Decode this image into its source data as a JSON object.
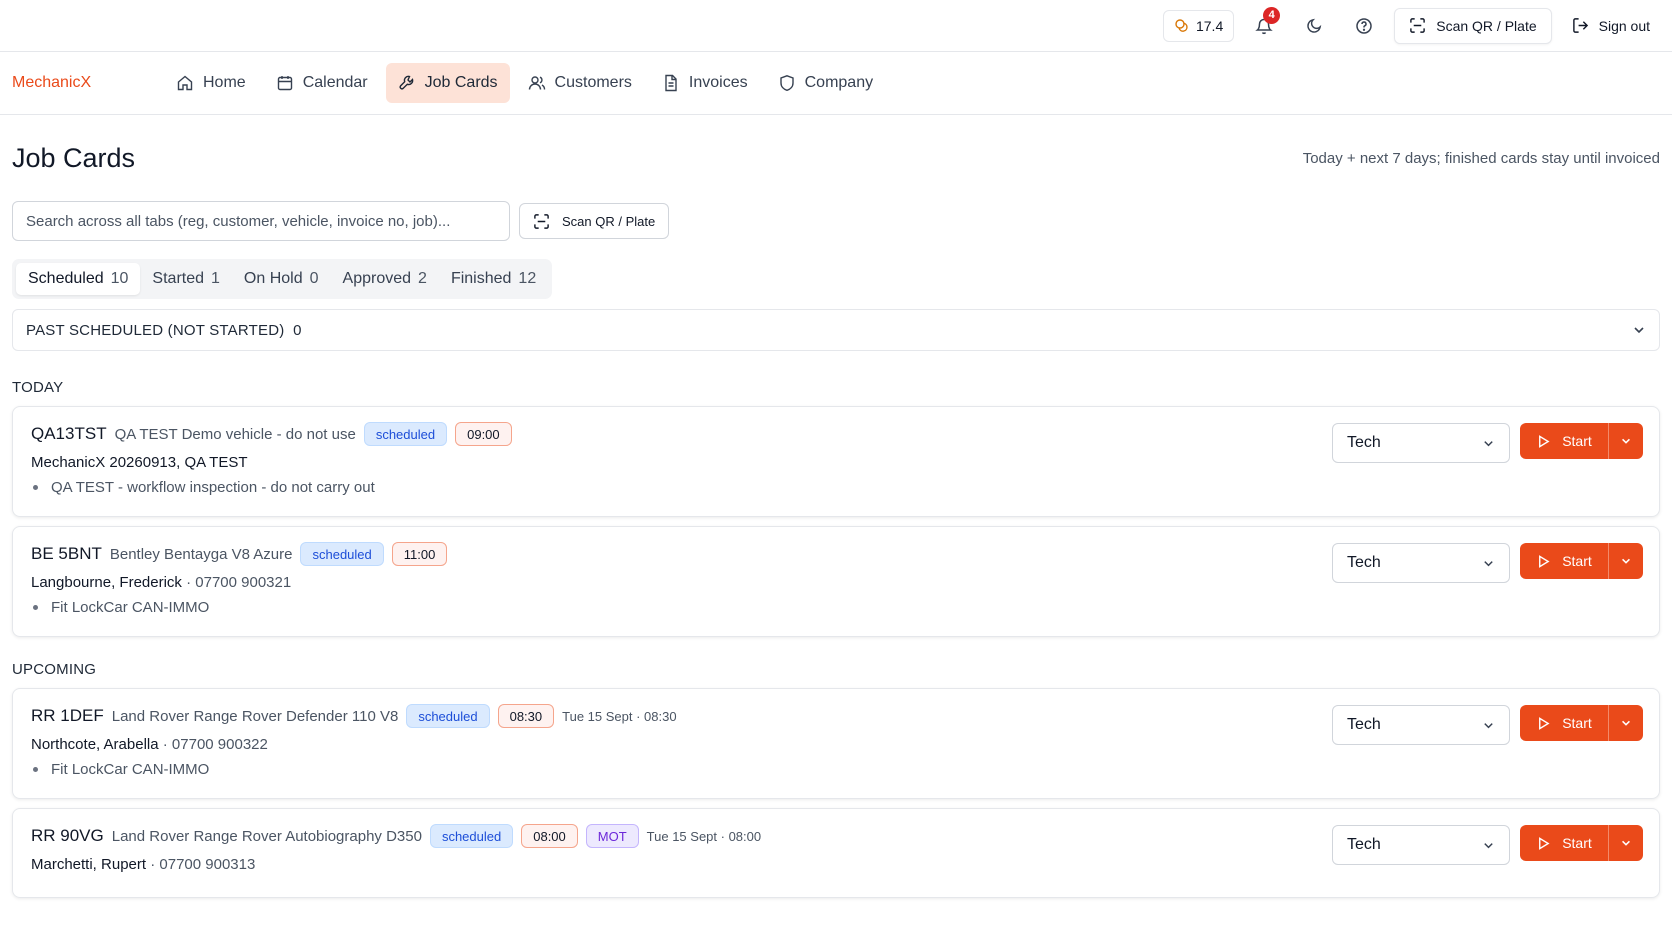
{
  "topbar": {
    "credits": "17.4",
    "notifications_count": "4",
    "scan_label": "Scan QR / Plate",
    "signout_label": "Sign out"
  },
  "nav": {
    "brand": "MechanicX",
    "items": [
      {
        "label": "Home",
        "icon": "home-icon"
      },
      {
        "label": "Calendar",
        "icon": "calendar-icon"
      },
      {
        "label": "Job Cards",
        "icon": "wrench-icon",
        "active": true
      },
      {
        "label": "Customers",
        "icon": "users-icon"
      },
      {
        "label": "Invoices",
        "icon": "document-icon"
      },
      {
        "label": "Company",
        "icon": "shield-icon"
      }
    ]
  },
  "page": {
    "title": "Job Cards",
    "note": "Today + next 7 days; finished cards stay until invoiced",
    "search_placeholder": "Search across all tabs (reg, customer, vehicle, invoice no, job)...",
    "scan_label": "Scan QR / Plate"
  },
  "tabs": [
    {
      "label": "Scheduled",
      "count": "10",
      "active": true
    },
    {
      "label": "Started",
      "count": "1"
    },
    {
      "label": "On Hold",
      "count": "0"
    },
    {
      "label": "Approved",
      "count": "2"
    },
    {
      "label": "Finished",
      "count": "12"
    }
  ],
  "past_scheduled": {
    "label": "PAST SCHEDULED (NOT STARTED)",
    "count": "0"
  },
  "sections": {
    "today_label": "TODAY",
    "upcoming_label": "UPCOMING"
  },
  "cards": [
    {
      "reg": "QA13TST",
      "vehicle": "QA TEST Demo vehicle - do not use",
      "status": "scheduled",
      "time": "09:00",
      "customer": "MechanicX 20260913, QA TEST",
      "phone": "",
      "job": "QA TEST - workflow inspection - do not carry out",
      "tech": "Tech",
      "start_label": "Start"
    },
    {
      "reg": "BE 5BNT",
      "vehicle": "Bentley Bentayga V8 Azure",
      "status": "scheduled",
      "time": "11:00",
      "customer": "Langbourne, Frederick",
      "phone": "· 07700 900321",
      "job": "Fit LockCar CAN-IMMO",
      "tech": "Tech",
      "start_label": "Start"
    },
    {
      "reg": "RR 1DEF",
      "vehicle": "Land Rover Range Rover Defender 110 V8",
      "status": "scheduled",
      "time": "08:30",
      "when": "Tue 15 Sept · 08:30",
      "customer": "Northcote, Arabella",
      "phone": "· 07700 900322",
      "job": "Fit LockCar CAN-IMMO",
      "tech": "Tech",
      "start_label": "Start"
    },
    {
      "reg": "RR 90VG",
      "vehicle": "Land Rover Range Rover Autobiography D350",
      "status": "scheduled",
      "time": "08:00",
      "tag": "MOT",
      "when": "Tue 15 Sept · 08:00",
      "customer": "Marchetti, Rupert",
      "phone": "· 07700 900313",
      "tech": "Tech",
      "start_label": "Start"
    }
  ],
  "colors": {
    "accent": "#ea4a1a",
    "active_nav_bg": "#fde2d7",
    "status_blue": "#1d4ed8",
    "mot_purple": "#6d28d9"
  }
}
